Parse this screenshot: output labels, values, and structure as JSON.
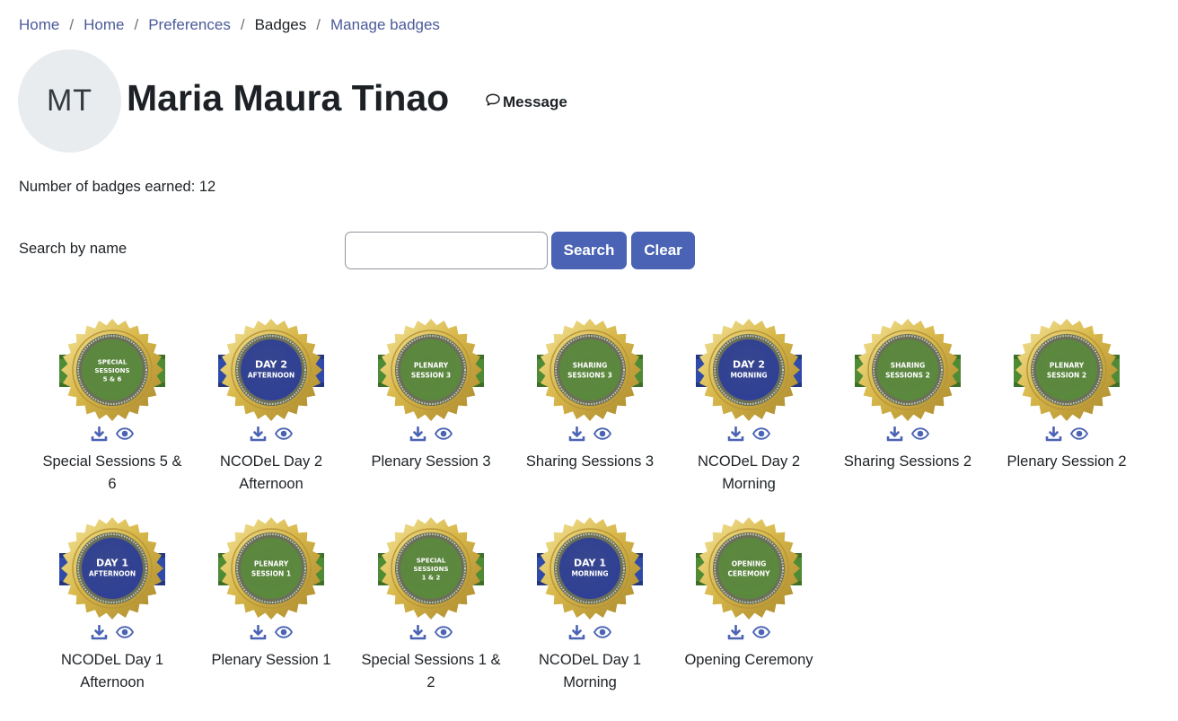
{
  "breadcrumb": [
    {
      "label": "Home",
      "link": true
    },
    {
      "label": "Home",
      "link": true
    },
    {
      "label": "Preferences",
      "link": true
    },
    {
      "label": "Badges",
      "link": false
    },
    {
      "label": "Manage badges",
      "link": true
    }
  ],
  "user": {
    "initials": "MT",
    "name": "Maria Maura Tinao",
    "message_label": "Message"
  },
  "badges_earned_text": "Number of badges earned: 12",
  "search": {
    "label": "Search by name",
    "value": "",
    "placeholder": "",
    "search_button": "Search",
    "clear_button": "Clear"
  },
  "icons": {
    "download": "download-icon",
    "view": "eye-icon",
    "message": "chat-bubble-icon"
  },
  "colors": {
    "accent": "#4a63b4",
    "link": "#4b5a99",
    "badge_green": "#5a8a3c",
    "badge_blue": "#2e3f96",
    "badge_gold": "#d8b84a"
  },
  "badges": [
    {
      "name": "Special Sessions 5 & 6",
      "emblem": [
        "SPECIAL",
        "SESSIONS",
        "5 & 6"
      ],
      "theme": "green"
    },
    {
      "name": "NCODeL Day 2 Afternoon",
      "emblem": [
        "DAY 2",
        "AFTERNOON"
      ],
      "theme": "blue"
    },
    {
      "name": "Plenary Session 3",
      "emblem": [
        "PLENARY",
        "SESSION 3"
      ],
      "theme": "green"
    },
    {
      "name": "Sharing Sessions 3",
      "emblem": [
        "SHARING",
        "SESSIONS 3"
      ],
      "theme": "green"
    },
    {
      "name": "NCODeL Day 2 Morning",
      "emblem": [
        "DAY 2",
        "MORNING"
      ],
      "theme": "blue"
    },
    {
      "name": "Sharing Sessions 2",
      "emblem": [
        "SHARING",
        "SESSIONS 2"
      ],
      "theme": "green"
    },
    {
      "name": "Plenary Session 2",
      "emblem": [
        "PLENARY",
        "SESSION 2"
      ],
      "theme": "green"
    },
    {
      "name": "NCODeL Day 1 Afternoon",
      "emblem": [
        "DAY 1",
        "AFTERNOON"
      ],
      "theme": "blue"
    },
    {
      "name": "Plenary Session 1",
      "emblem": [
        "PLENARY",
        "SESSION 1"
      ],
      "theme": "green"
    },
    {
      "name": "Special Sessions 1 & 2",
      "emblem": [
        "SPECIAL",
        "SESSIONS",
        "1 & 2"
      ],
      "theme": "green"
    },
    {
      "name": "NCODeL Day 1 Morning",
      "emblem": [
        "DAY 1",
        "MORNING"
      ],
      "theme": "blue"
    },
    {
      "name": "Opening Ceremony",
      "emblem": [
        "OPENING",
        "CEREMONY"
      ],
      "theme": "green"
    }
  ]
}
